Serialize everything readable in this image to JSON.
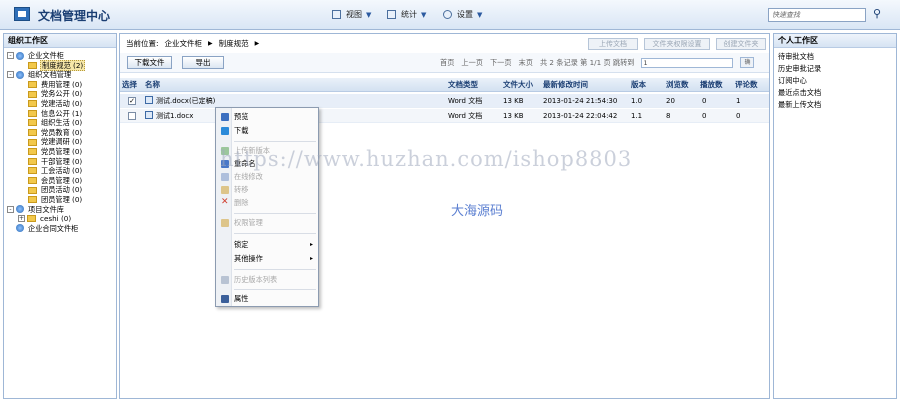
{
  "header": {
    "title": "文档管理中心",
    "menu": [
      {
        "label": "视图",
        "icon": "view-icon"
      },
      {
        "label": "统计",
        "icon": "chart-icon"
      },
      {
        "label": "设置",
        "icon": "gear-icon"
      }
    ],
    "search_placeholder": "快速查找"
  },
  "left_panel": {
    "title": "组织工作区",
    "tree": [
      {
        "label": "企业文件柜",
        "toggle": "-",
        "icon": "cabinet-icon",
        "level": 0
      },
      {
        "label": "制度规范 (2)",
        "icon": "folder-icon",
        "level": 1,
        "selected": true
      },
      {
        "label": "组织文档管理",
        "toggle": "-",
        "icon": "cabinet-icon",
        "level": 0
      },
      {
        "label": "费用管理 (0)",
        "icon": "folder-icon",
        "level": 1
      },
      {
        "label": "党务公开 (0)",
        "icon": "folder-icon",
        "level": 1
      },
      {
        "label": "党建活动 (0)",
        "icon": "folder-icon",
        "level": 1
      },
      {
        "label": "信息公开 (1)",
        "icon": "folder-icon",
        "level": 1
      },
      {
        "label": "组织生活 (0)",
        "icon": "folder-icon",
        "level": 1
      },
      {
        "label": "党员教育 (0)",
        "icon": "folder-icon",
        "level": 1
      },
      {
        "label": "党建调研 (0)",
        "icon": "folder-icon",
        "level": 1
      },
      {
        "label": "党员管理 (0)",
        "icon": "folder-icon",
        "level": 1
      },
      {
        "label": "干部管理 (0)",
        "icon": "folder-icon",
        "level": 1
      },
      {
        "label": "工会活动 (0)",
        "icon": "folder-icon",
        "level": 1
      },
      {
        "label": "会员管理 (0)",
        "icon": "folder-icon",
        "level": 1
      },
      {
        "label": "团员活动 (0)",
        "icon": "folder-icon",
        "level": 1
      },
      {
        "label": "团员管理 (0)",
        "icon": "folder-icon",
        "level": 1
      },
      {
        "label": "项目文件库",
        "toggle": "-",
        "icon": "cabinet-icon",
        "level": 0
      },
      {
        "label": "ceshi (0)",
        "toggle": "+",
        "icon": "folder-icon",
        "level": 1
      },
      {
        "label": "企业合同文件柜",
        "icon": "cabinet-icon",
        "level": 0
      }
    ]
  },
  "main": {
    "breadcrumb": {
      "prefix": "当前位置:",
      "items": [
        "企业文件柜",
        "制度规范"
      ]
    },
    "top_buttons": [
      "上传文档",
      "文件夹权限设置",
      "创建文件夹"
    ],
    "toolbar": {
      "download": "下载文件",
      "import": "导出"
    },
    "pager": {
      "first": "首页",
      "prev": "上一页",
      "next": "下一页",
      "last": "末页",
      "summary": "共 2 条记录 第 1/1 页 跳转到",
      "input_value": "1",
      "go": "确"
    },
    "columns": [
      "选择",
      "名称",
      "文档类型",
      "文件大小",
      "最新修改时间",
      "版本",
      "浏览数",
      "播放数",
      "评论数"
    ],
    "rows": [
      {
        "checked": "✓",
        "name": "测试.docx(已定稿)",
        "type": "Word 文档",
        "size": "13 KB",
        "modified": "2013-01-24 21:54:30",
        "version": "1.0",
        "views": "20",
        "plays": "0",
        "comments": "1"
      },
      {
        "checked": "",
        "name": "测试1.docx",
        "type": "Word 文档",
        "size": "13 KB",
        "modified": "2013-01-24 22:04:42",
        "version": "1.1",
        "views": "8",
        "plays": "0",
        "comments": "0"
      }
    ]
  },
  "context_menu": {
    "items": [
      {
        "label": "预览",
        "disabled": false,
        "color": "#3b6fc0"
      },
      {
        "label": "下载",
        "disabled": false,
        "color": "#2b8ad9"
      },
      {
        "label": "上传新版本",
        "disabled": true,
        "color": "#5aa85a"
      },
      {
        "label": "重命名",
        "disabled": false,
        "color": "#4a78c8"
      },
      {
        "label": "在线修改",
        "disabled": true,
        "color": "#6a8fd0"
      },
      {
        "label": "转移",
        "disabled": true,
        "color": "#c8a040"
      },
      {
        "label": "删除",
        "disabled": true,
        "color": "#d04030"
      },
      {
        "label": "权限管理",
        "disabled": true,
        "color": "#c8a040"
      },
      {
        "label": "锁定",
        "disabled": false,
        "submenu": "▸"
      },
      {
        "label": "其他操作",
        "disabled": false,
        "submenu": "▸"
      },
      {
        "label": "历史版本列表",
        "disabled": true,
        "color": "#7c8fa8"
      },
      {
        "label": "属性",
        "disabled": false,
        "color": "#3b5f9a"
      }
    ]
  },
  "right_panel": {
    "title": "个人工作区",
    "links": [
      "待审批文档",
      "历史审批记录",
      "订阅中心",
      "最近点击文档",
      "最新上传文档"
    ]
  },
  "watermark": {
    "url": "https://www.huzhan.com/ishop8803",
    "brand": "大海源码"
  }
}
